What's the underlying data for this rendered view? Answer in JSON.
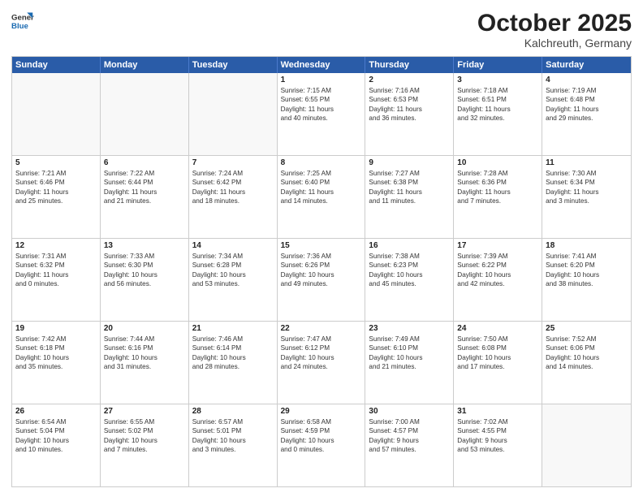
{
  "header": {
    "logo_general": "General",
    "logo_blue": "Blue",
    "month": "October 2025",
    "location": "Kalchreuth, Germany"
  },
  "weekdays": [
    "Sunday",
    "Monday",
    "Tuesday",
    "Wednesday",
    "Thursday",
    "Friday",
    "Saturday"
  ],
  "rows": [
    [
      {
        "day": "",
        "info": [],
        "empty": true
      },
      {
        "day": "",
        "info": [],
        "empty": true
      },
      {
        "day": "",
        "info": [],
        "empty": true
      },
      {
        "day": "1",
        "info": [
          "Sunrise: 7:15 AM",
          "Sunset: 6:55 PM",
          "Daylight: 11 hours",
          "and 40 minutes."
        ],
        "empty": false
      },
      {
        "day": "2",
        "info": [
          "Sunrise: 7:16 AM",
          "Sunset: 6:53 PM",
          "Daylight: 11 hours",
          "and 36 minutes."
        ],
        "empty": false
      },
      {
        "day": "3",
        "info": [
          "Sunrise: 7:18 AM",
          "Sunset: 6:51 PM",
          "Daylight: 11 hours",
          "and 32 minutes."
        ],
        "empty": false
      },
      {
        "day": "4",
        "info": [
          "Sunrise: 7:19 AM",
          "Sunset: 6:48 PM",
          "Daylight: 11 hours",
          "and 29 minutes."
        ],
        "empty": false
      }
    ],
    [
      {
        "day": "5",
        "info": [
          "Sunrise: 7:21 AM",
          "Sunset: 6:46 PM",
          "Daylight: 11 hours",
          "and 25 minutes."
        ],
        "empty": false
      },
      {
        "day": "6",
        "info": [
          "Sunrise: 7:22 AM",
          "Sunset: 6:44 PM",
          "Daylight: 11 hours",
          "and 21 minutes."
        ],
        "empty": false
      },
      {
        "day": "7",
        "info": [
          "Sunrise: 7:24 AM",
          "Sunset: 6:42 PM",
          "Daylight: 11 hours",
          "and 18 minutes."
        ],
        "empty": false
      },
      {
        "day": "8",
        "info": [
          "Sunrise: 7:25 AM",
          "Sunset: 6:40 PM",
          "Daylight: 11 hours",
          "and 14 minutes."
        ],
        "empty": false
      },
      {
        "day": "9",
        "info": [
          "Sunrise: 7:27 AM",
          "Sunset: 6:38 PM",
          "Daylight: 11 hours",
          "and 11 minutes."
        ],
        "empty": false
      },
      {
        "day": "10",
        "info": [
          "Sunrise: 7:28 AM",
          "Sunset: 6:36 PM",
          "Daylight: 11 hours",
          "and 7 minutes."
        ],
        "empty": false
      },
      {
        "day": "11",
        "info": [
          "Sunrise: 7:30 AM",
          "Sunset: 6:34 PM",
          "Daylight: 11 hours",
          "and 3 minutes."
        ],
        "empty": false
      }
    ],
    [
      {
        "day": "12",
        "info": [
          "Sunrise: 7:31 AM",
          "Sunset: 6:32 PM",
          "Daylight: 11 hours",
          "and 0 minutes."
        ],
        "empty": false
      },
      {
        "day": "13",
        "info": [
          "Sunrise: 7:33 AM",
          "Sunset: 6:30 PM",
          "Daylight: 10 hours",
          "and 56 minutes."
        ],
        "empty": false
      },
      {
        "day": "14",
        "info": [
          "Sunrise: 7:34 AM",
          "Sunset: 6:28 PM",
          "Daylight: 10 hours",
          "and 53 minutes."
        ],
        "empty": false
      },
      {
        "day": "15",
        "info": [
          "Sunrise: 7:36 AM",
          "Sunset: 6:26 PM",
          "Daylight: 10 hours",
          "and 49 minutes."
        ],
        "empty": false
      },
      {
        "day": "16",
        "info": [
          "Sunrise: 7:38 AM",
          "Sunset: 6:23 PM",
          "Daylight: 10 hours",
          "and 45 minutes."
        ],
        "empty": false
      },
      {
        "day": "17",
        "info": [
          "Sunrise: 7:39 AM",
          "Sunset: 6:22 PM",
          "Daylight: 10 hours",
          "and 42 minutes."
        ],
        "empty": false
      },
      {
        "day": "18",
        "info": [
          "Sunrise: 7:41 AM",
          "Sunset: 6:20 PM",
          "Daylight: 10 hours",
          "and 38 minutes."
        ],
        "empty": false
      }
    ],
    [
      {
        "day": "19",
        "info": [
          "Sunrise: 7:42 AM",
          "Sunset: 6:18 PM",
          "Daylight: 10 hours",
          "and 35 minutes."
        ],
        "empty": false
      },
      {
        "day": "20",
        "info": [
          "Sunrise: 7:44 AM",
          "Sunset: 6:16 PM",
          "Daylight: 10 hours",
          "and 31 minutes."
        ],
        "empty": false
      },
      {
        "day": "21",
        "info": [
          "Sunrise: 7:46 AM",
          "Sunset: 6:14 PM",
          "Daylight: 10 hours",
          "and 28 minutes."
        ],
        "empty": false
      },
      {
        "day": "22",
        "info": [
          "Sunrise: 7:47 AM",
          "Sunset: 6:12 PM",
          "Daylight: 10 hours",
          "and 24 minutes."
        ],
        "empty": false
      },
      {
        "day": "23",
        "info": [
          "Sunrise: 7:49 AM",
          "Sunset: 6:10 PM",
          "Daylight: 10 hours",
          "and 21 minutes."
        ],
        "empty": false
      },
      {
        "day": "24",
        "info": [
          "Sunrise: 7:50 AM",
          "Sunset: 6:08 PM",
          "Daylight: 10 hours",
          "and 17 minutes."
        ],
        "empty": false
      },
      {
        "day": "25",
        "info": [
          "Sunrise: 7:52 AM",
          "Sunset: 6:06 PM",
          "Daylight: 10 hours",
          "and 14 minutes."
        ],
        "empty": false
      }
    ],
    [
      {
        "day": "26",
        "info": [
          "Sunrise: 6:54 AM",
          "Sunset: 5:04 PM",
          "Daylight: 10 hours",
          "and 10 minutes."
        ],
        "empty": false
      },
      {
        "day": "27",
        "info": [
          "Sunrise: 6:55 AM",
          "Sunset: 5:02 PM",
          "Daylight: 10 hours",
          "and 7 minutes."
        ],
        "empty": false
      },
      {
        "day": "28",
        "info": [
          "Sunrise: 6:57 AM",
          "Sunset: 5:01 PM",
          "Daylight: 10 hours",
          "and 3 minutes."
        ],
        "empty": false
      },
      {
        "day": "29",
        "info": [
          "Sunrise: 6:58 AM",
          "Sunset: 4:59 PM",
          "Daylight: 10 hours",
          "and 0 minutes."
        ],
        "empty": false
      },
      {
        "day": "30",
        "info": [
          "Sunrise: 7:00 AM",
          "Sunset: 4:57 PM",
          "Daylight: 9 hours",
          "and 57 minutes."
        ],
        "empty": false
      },
      {
        "day": "31",
        "info": [
          "Sunrise: 7:02 AM",
          "Sunset: 4:55 PM",
          "Daylight: 9 hours",
          "and 53 minutes."
        ],
        "empty": false
      },
      {
        "day": "",
        "info": [],
        "empty": true
      }
    ]
  ]
}
